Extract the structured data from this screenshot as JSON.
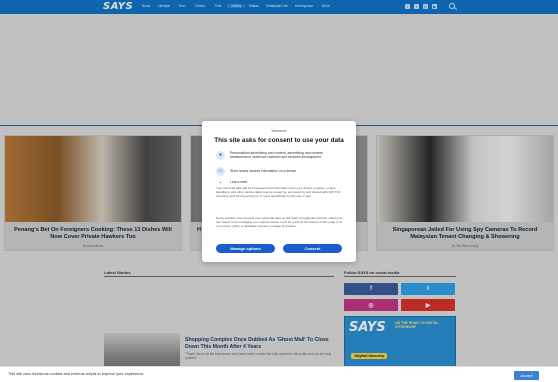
{
  "header": {
    "logo": "SAYS",
    "nav": [
      "News",
      "Lifestyle",
      "Tech",
      "Geeks",
      "Pets",
      "Videos",
      "Makan",
      "Malaysian Life",
      "Homegrown",
      "More"
    ],
    "active_nav_index": 5
  },
  "cards": [
    {
      "title": "Penang's Bet On Foreigners Cooking: These 13 Dishes Will Now Cover Private Hawkers Too",
      "meta": "by Dana Alves"
    },
    {
      "title": "H",
      "meta": ""
    },
    {
      "title": "Singaporean Jailed For Using Spy Cameras To Record Malaysian Tenant Changing & Showering",
      "meta": "by Tse Wah Leong"
    }
  ],
  "latest": {
    "label": "Latest Stories",
    "story_title": "Shopping Complex Once Dubbed As 'Ghost Mall' To Close Down This Month After 4 Years",
    "story_snippet": "\"Thank You to all the businesses who have come in since the mall opened to the public and we are truly grateful.\""
  },
  "follow": {
    "label": "Follow SAYS on social media",
    "networks": [
      "facebook",
      "twitter",
      "instagram",
      "youtube"
    ],
    "ad_brand": "SAYS",
    "ad_text": "ON THE ROAD TO DIGITAL CITIZENSHIP",
    "ad_pill": "#DigitalCitizenship"
  },
  "consent": {
    "welcome": "Welcome",
    "title": "This site asks for consent to use your data",
    "purposes": [
      {
        "icon": "person-icon",
        "text": "Personalised advertising and content, advertising and content measurement, audience research and services development"
      },
      {
        "icon": "device-icon",
        "text": "Store and/or access information on a device"
      }
    ],
    "learn_more": "Learn more",
    "body1": "Your personal data will be processed and information from your device (cookies, unique identifiers, and other device data) may be stored by, accessed by and shared with 125 TCF vendor(s) and 63 ad partner(s), or used specifically by this site or app.",
    "body2": "Some vendors may process your personal data on the basis of legitimate interest, which you can object to by managing your options below. Look for a link at the bottom of this page or in our privacy policy to withdraw consent to usage of cookies.",
    "manage_label": "Manage options",
    "consent_label": "Consent"
  },
  "cookie_bar": {
    "text": "This site uses functional cookies and external scripts to improve your experience.",
    "accept": "Accept"
  }
}
